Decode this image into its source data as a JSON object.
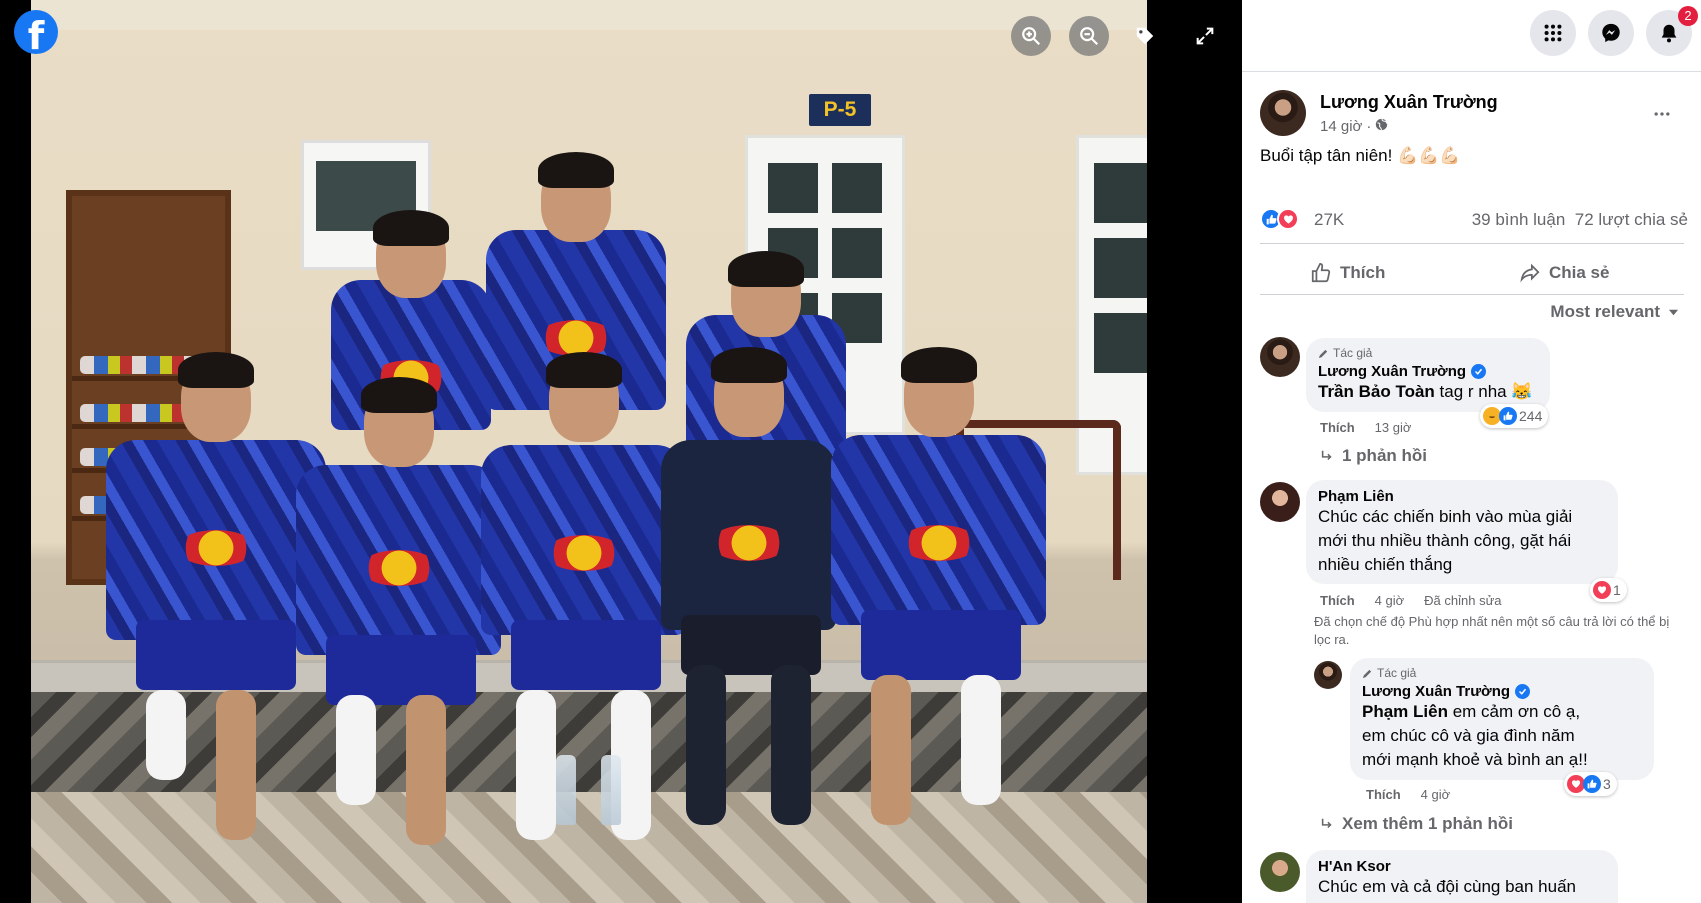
{
  "viewer": {
    "door_sign": "P-5",
    "controls": [
      {
        "name": "zoom-in-icon"
      },
      {
        "name": "zoom-out-icon"
      },
      {
        "name": "tag-icon"
      },
      {
        "name": "fullscreen-icon"
      }
    ]
  },
  "topbar": {
    "icons": [
      "menu-grid-icon",
      "messenger-icon",
      "notifications-icon"
    ],
    "notification_count": "2"
  },
  "post": {
    "author": "Lương Xuân Trường",
    "time": "14 giờ",
    "privacy_sep": "·",
    "text": "Buổi tập tân niên! 💪🏻💪🏻💪🏻",
    "reaction_count": "27K",
    "comments_count": "39 bình luận",
    "shares_count": "72 lượt chia sẻ",
    "like_label": "Thích",
    "share_label": "Chia sẻ",
    "sort_label": "Most relevant"
  },
  "comments": [
    {
      "author_tag": "Tác giả",
      "name": "Lương Xuân Trường",
      "mention": "Trần Bảo Toàn",
      "text": " tag r nha 😹",
      "like": "Thích",
      "time": "13 giờ",
      "reaction_count": "244",
      "replies_link": "1 phản hồi"
    },
    {
      "name": "Phạm Liên",
      "text_lines": [
        "Chúc các chiến binh vào mùa giải",
        "mới thu nhiều thành công, gặt hái",
        "nhiều chiến thắng"
      ],
      "like": "Thích",
      "time": "4 giờ",
      "edited": "Đã chỉnh sửa",
      "reaction_count": "1",
      "filter_note": "Đã chọn chế độ Phù hợp nhất nên một số câu trả lời có thể bị lọc ra."
    },
    {
      "author_tag": "Tác giả",
      "name": "Lương Xuân Trường",
      "mention": "Phạm Liên",
      "text_lines": [
        " em cảm ơn cô ạ,",
        "em chúc cô và gia đình năm",
        "mới mạnh khoẻ và bình an ạ!!"
      ],
      "like": "Thích",
      "time": "4 giờ",
      "reaction_count": "3",
      "more_replies": "Xem thêm 1 phản hồi"
    },
    {
      "name": "H'An Ksor",
      "text": "Chúc em và cả đội cùng ban huấn"
    }
  ],
  "colors": {
    "facebook_blue": "#1877f2",
    "secondary_text": "#65676b",
    "bubble_bg": "#f0f2f5",
    "badge_red": "#e41e3f"
  }
}
